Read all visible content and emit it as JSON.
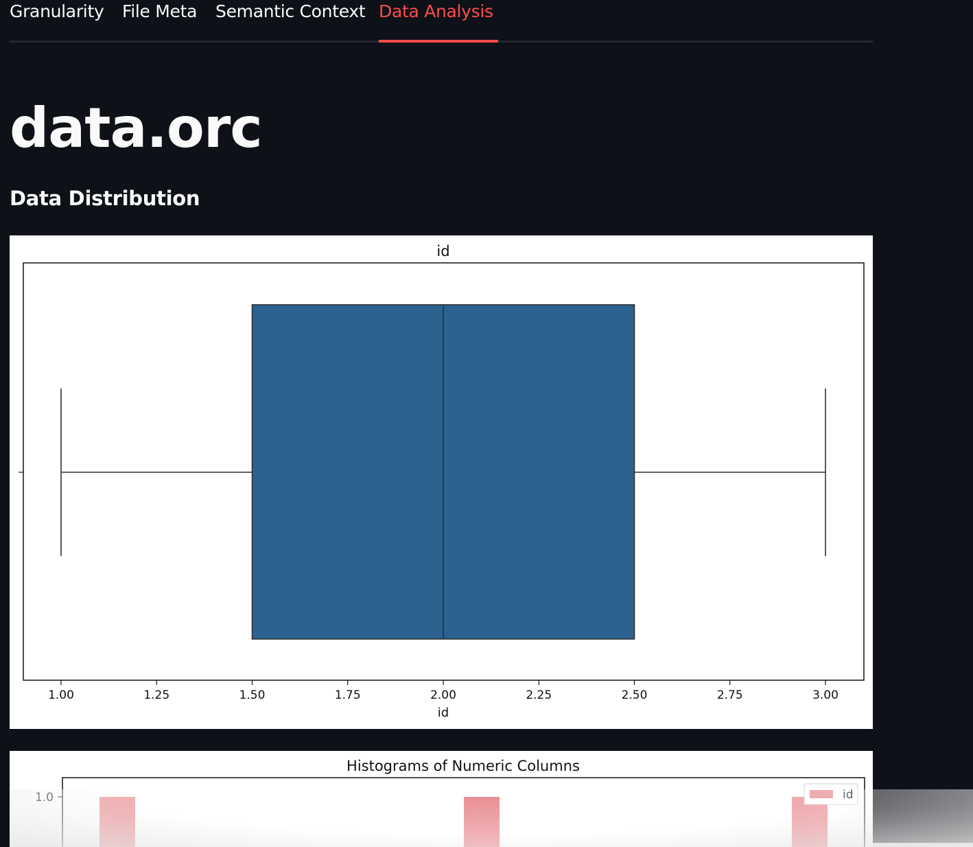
{
  "tabs": [
    {
      "label": "Granularity",
      "active": false
    },
    {
      "label": "File Meta",
      "active": false
    },
    {
      "label": "Semantic Context",
      "active": false
    },
    {
      "label": "Data Analysis",
      "active": true
    }
  ],
  "page": {
    "title": "data.orc",
    "section_title": "Data Distribution"
  },
  "colors": {
    "accent": "#ff4b4b",
    "background": "#0e1117",
    "box_fill": "#2b628f",
    "hist_fill": "#e8888d"
  },
  "chart_data": [
    {
      "type": "box",
      "title": "id",
      "xlabel": "id",
      "ylabel": "",
      "xlim": [
        0.9,
        3.1
      ],
      "xticks": [
        "1.00",
        "1.25",
        "1.50",
        "1.75",
        "2.00",
        "2.25",
        "2.50",
        "2.75",
        "3.00"
      ],
      "stats": {
        "min": 1.0,
        "q1": 1.5,
        "median": 2.0,
        "q3": 2.5,
        "max": 3.0
      },
      "grid": false
    },
    {
      "type": "bar",
      "title": "Histograms of Numeric Columns",
      "series": [
        {
          "name": "id",
          "x": [
            1,
            2,
            3
          ],
          "values": [
            1.0,
            1.0,
            1.0
          ]
        }
      ],
      "yticks": [
        "1.0"
      ],
      "legend": "top-right",
      "grid": false
    }
  ]
}
